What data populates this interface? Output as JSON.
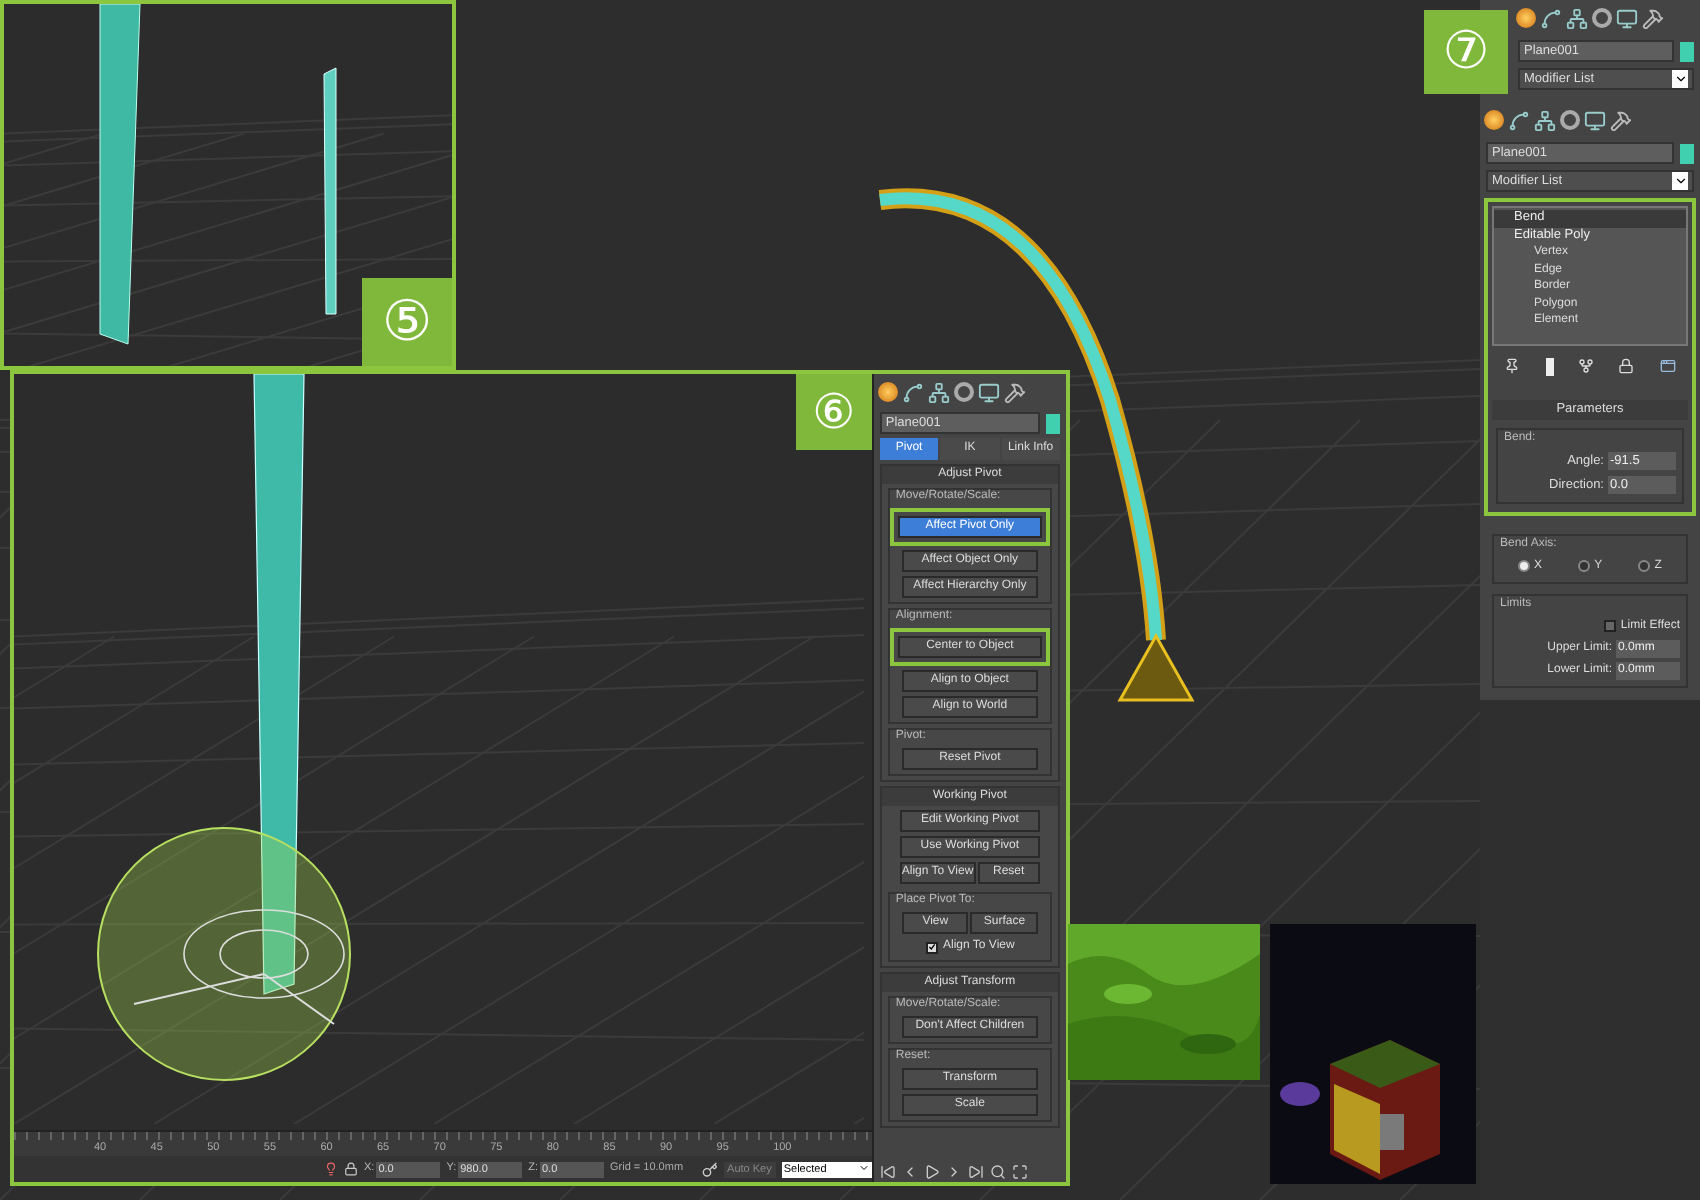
{
  "top_inset": {
    "badge": "⑤"
  },
  "pivot_inset": {
    "badge": "⑥",
    "command_panel": {
      "object_name": "Plane001",
      "tabs": [
        {
          "label": "Pivot",
          "selected": true
        },
        {
          "label": "IK",
          "selected": false
        },
        {
          "label": "Link Info",
          "selected": false
        }
      ],
      "rollouts": [
        {
          "title": "Adjust Pivot",
          "groups": [
            {
              "title": "Move/Rotate/Scale:",
              "rows": [
                [
                  {
                    "kind": "button",
                    "label": "Affect Pivot Only",
                    "selected": true,
                    "highlighted": true
                  }
                ],
                [
                  {
                    "kind": "button",
                    "label": "Affect Object Only",
                    "selected": false,
                    "highlighted": false
                  }
                ],
                [
                  {
                    "kind": "button",
                    "label": "Affect Hierarchy Only",
                    "selected": false,
                    "highlighted": false
                  }
                ]
              ]
            },
            {
              "title": "Alignment:",
              "rows": [
                [
                  {
                    "kind": "button",
                    "label": "Center to Object",
                    "selected": false,
                    "highlighted": true
                  }
                ],
                [
                  {
                    "kind": "button",
                    "label": "Align to Object",
                    "selected": false,
                    "highlighted": false
                  }
                ],
                [
                  {
                    "kind": "button",
                    "label": "Align to World",
                    "selected": false,
                    "highlighted": false
                  }
                ]
              ]
            },
            {
              "title": "Pivot:",
              "rows": [
                [
                  {
                    "kind": "button",
                    "label": "Reset Pivot",
                    "selected": false,
                    "highlighted": false
                  }
                ]
              ]
            }
          ]
        },
        {
          "title": "Working Pivot",
          "groups": [
            {
              "rows": [
                [
                  {
                    "kind": "button",
                    "label": "Edit Working Pivot",
                    "selected": false,
                    "highlighted": false
                  }
                ],
                [
                  {
                    "kind": "button",
                    "label": "Use Working Pivot",
                    "selected": false,
                    "highlighted": false
                  }
                ],
                [
                  {
                    "kind": "button",
                    "label": "Align To View",
                    "selected": false,
                    "highlighted": false
                  },
                  {
                    "kind": "button",
                    "label": "Reset",
                    "selected": false,
                    "highlighted": false
                  }
                ]
              ]
            },
            {
              "title": "Place Pivot To:",
              "rows": [
                [
                  {
                    "kind": "button",
                    "label": "View",
                    "selected": false,
                    "highlighted": false
                  },
                  {
                    "kind": "button",
                    "label": "Surface",
                    "selected": false,
                    "highlighted": false
                  }
                ],
                [
                  {
                    "kind": "checkbox",
                    "label": "Align To View",
                    "checked": true
                  }
                ]
              ]
            }
          ]
        },
        {
          "title": "Adjust Transform",
          "groups": [
            {
              "title": "Move/Rotate/Scale:",
              "rows": [
                [
                  {
                    "kind": "button",
                    "label": "Don't Affect Children",
                    "selected": false,
                    "highlighted": false
                  }
                ]
              ]
            },
            {
              "title": "Reset:",
              "rows": [
                [
                  {
                    "kind": "button",
                    "label": "Transform",
                    "selected": false,
                    "highlighted": false
                  }
                ],
                [
                  {
                    "kind": "button",
                    "label": "Scale",
                    "selected": false,
                    "highlighted": false
                  }
                ]
              ]
            }
          ]
        }
      ]
    },
    "timeline": {
      "ticks": [
        "40",
        "45",
        "50",
        "55",
        "60",
        "65",
        "70",
        "75",
        "80",
        "85",
        "90",
        "95",
        "100"
      ],
      "fields": [
        {
          "label": "X:",
          "value": "0.0"
        },
        {
          "label": "Y:",
          "value": "980.0"
        },
        {
          "label": "Z:",
          "value": "0.0"
        }
      ],
      "grid": "Grid = 10.0mm",
      "auto_key": "Auto Key",
      "key_mode": "Selected"
    }
  },
  "right_panel": {
    "badge": "⑦",
    "header": {
      "object_name": "Plane001",
      "modifier_list": "Modifier List"
    },
    "object_name": "Plane001",
    "modifier_list": "Modifier List",
    "stack": [
      {
        "label": "Bend",
        "selected": true
      },
      {
        "label": "Editable Poly",
        "selected": false,
        "children": [
          {
            "label": "Vertex",
            "selected": false
          },
          {
            "label": "Edge",
            "selected": false
          },
          {
            "label": "Border",
            "selected": false
          },
          {
            "label": "Polygon",
            "selected": false
          },
          {
            "label": "Element",
            "selected": false
          }
        ]
      }
    ],
    "parameters": {
      "title": "Parameters",
      "bend": {
        "title": "Bend:",
        "fields": [
          {
            "label": "Angle:",
            "value": "-91.5"
          },
          {
            "label": "Direction:",
            "value": "0.0"
          }
        ]
      },
      "bend_axis": {
        "title": "Bend Axis:",
        "options": [
          {
            "label": "X",
            "selected": true
          },
          {
            "label": "Y",
            "selected": false
          },
          {
            "label": "Z",
            "selected": false
          }
        ]
      },
      "limits": {
        "title": "Limits",
        "limit_effect": {
          "label": "Limit Effect",
          "checked": false
        },
        "fields": [
          {
            "label": "Upper Limit:",
            "value": "0.0mm"
          },
          {
            "label": "Lower Limit:",
            "value": "0.0mm"
          }
        ]
      }
    }
  }
}
